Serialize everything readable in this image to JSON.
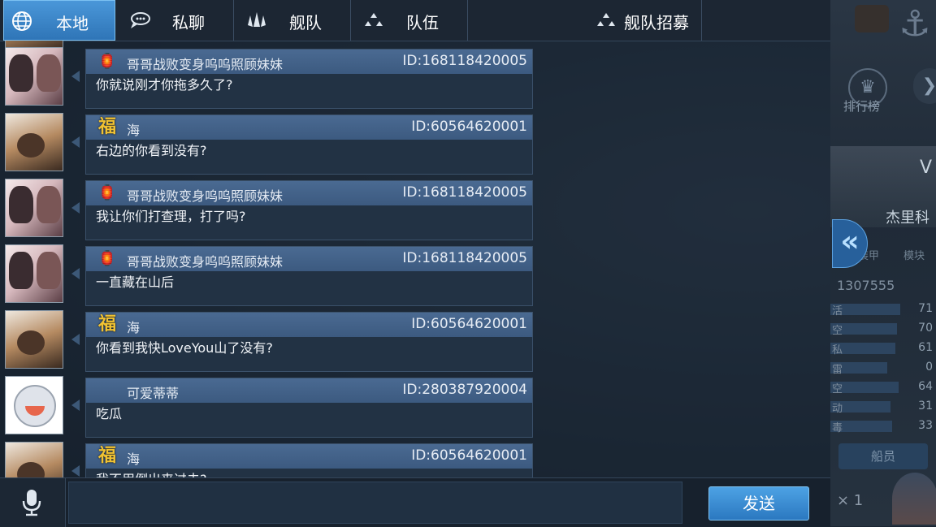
{
  "tabs": [
    {
      "label": "本地",
      "icon": "globe-icon",
      "active": true
    },
    {
      "label": "私聊",
      "icon": "speech-bubble-icon",
      "active": false
    },
    {
      "label": "舰队",
      "icon": "fleet-icon",
      "active": false
    },
    {
      "label": "队伍",
      "icon": "team-icon",
      "active": false
    },
    {
      "label": "舰队招募",
      "icon": "recruit-icon",
      "active": false
    }
  ],
  "messages": [
    {
      "sender": "哥哥战败变身呜呜照顾妹妹",
      "uid": "ID:168118420005",
      "text": "你就说刚才你拖多久了?",
      "badge": "lantern-icon",
      "avatar": "anime-girls-avatar"
    },
    {
      "sender": "海",
      "uid": "ID:60564620001",
      "text": "右边的你看到没有?",
      "badge": "fu-badge",
      "avatar": "photo-avatar"
    },
    {
      "sender": "哥哥战败变身呜呜照顾妹妹",
      "uid": "ID:168118420005",
      "text": "我让你们打查理，打了吗?",
      "badge": "lantern-icon",
      "avatar": "anime-girls-avatar"
    },
    {
      "sender": "哥哥战败变身呜呜照顾妹妹",
      "uid": "ID:168118420005",
      "text": "一直藏在山后",
      "badge": "lantern-icon",
      "avatar": "anime-girls-avatar"
    },
    {
      "sender": "海",
      "uid": "ID:60564620001",
      "text": "你看到我快LoveYou山了没有?",
      "badge": "fu-badge",
      "avatar": "photo-avatar"
    },
    {
      "sender": "可爱蒂蒂",
      "uid": "ID:280387920004",
      "text": "吃瓜",
      "badge": "",
      "avatar": "chibi-avatar"
    },
    {
      "sender": "海",
      "uid": "ID:60564620001",
      "text": "我不用倒出来过去?",
      "badge": "fu-badge",
      "avatar": "photo-avatar"
    }
  ],
  "badges": {
    "fu_char": "福",
    "lantern_char": "🏮"
  },
  "input": {
    "value": "",
    "placeholder": ""
  },
  "send_label": "发送",
  "collapse_glyph": "«",
  "right_panel": {
    "rank_label": "排行榜",
    "ship_letter": "V",
    "ship_name": "杰里科",
    "tab_armor": "装甲",
    "tab_module": "模块",
    "power": "1307555",
    "stats": [
      {
        "label": "活",
        "value": "71"
      },
      {
        "label": "空",
        "value": "70"
      },
      {
        "label": "私",
        "value": "61"
      },
      {
        "label": "雷",
        "value": "0"
      },
      {
        "label": "空",
        "value": "64"
      },
      {
        "label": "动",
        "value": "31"
      },
      {
        "label": "毒",
        "value": "33"
      }
    ],
    "crew_label": "船员",
    "multiplier": "× 1"
  },
  "colors": {
    "accent": "#2f75b7",
    "tab_bg": "#1c2633",
    "bubble_head": "#3c5a80",
    "fu_gold": "#f0c233",
    "lantern_red": "#e22b23"
  }
}
